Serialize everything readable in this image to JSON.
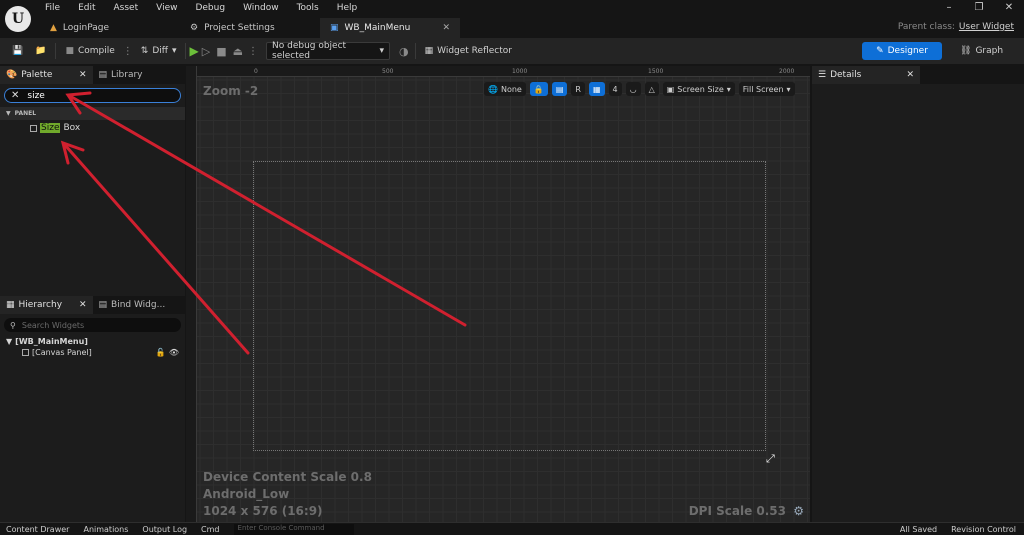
{
  "menu": [
    "File",
    "Edit",
    "Asset",
    "View",
    "Debug",
    "Window",
    "Tools",
    "Help"
  ],
  "tabs": [
    {
      "label": "LoginPage",
      "icon": "blueprint-icon"
    },
    {
      "label": "Project Settings",
      "icon": "gear-icon"
    },
    {
      "label": "WB_MainMenu",
      "icon": "widget-icon"
    }
  ],
  "parent_class": {
    "prefix": "Parent class:",
    "value": "User Widget"
  },
  "toolbar": {
    "compile": "Compile",
    "diff": "Diff",
    "debug_object": "No debug object selected",
    "widget_reflector": "Widget Reflector",
    "designer": "Designer",
    "graph": "Graph"
  },
  "palette": {
    "tab": "Palette",
    "library_tab": "Library",
    "search_value": "size",
    "category": "PANEL",
    "item_highlight": "Size",
    "item_rest": "Box"
  },
  "hierarchy": {
    "tab": "Hierarchy",
    "bind_tab": "Bind Widg...",
    "search_placeholder": "Search Widgets",
    "root": "[WB_MainMenu]",
    "child": "[Canvas Panel]"
  },
  "viewport": {
    "zoom": "Zoom -2",
    "ruler_top": [
      "0",
      "500",
      "1000",
      "1500",
      "2000"
    ],
    "none_label": "None",
    "r_label": "R",
    "grid_count": "4",
    "screen_size": "Screen Size",
    "fill_screen": "Fill Screen",
    "device_scale": "Device Content Scale 0.8",
    "device_name": "Android_Low",
    "resolution": "1024 x 576 (16:9)",
    "dpi_scale": "DPI Scale 0.53"
  },
  "details": {
    "tab": "Details"
  },
  "bottom": {
    "content_drawer": "Content Drawer",
    "animations": "Animations",
    "output_log": "Output Log",
    "cmd": "Cmd",
    "console_placeholder": "Enter Console Command",
    "all_saved": "All Saved",
    "revision_control": "Revision Control"
  },
  "colors": {
    "accent": "#0e6fd7",
    "highlight": "#70a92b",
    "arrow": "#d0202f"
  }
}
